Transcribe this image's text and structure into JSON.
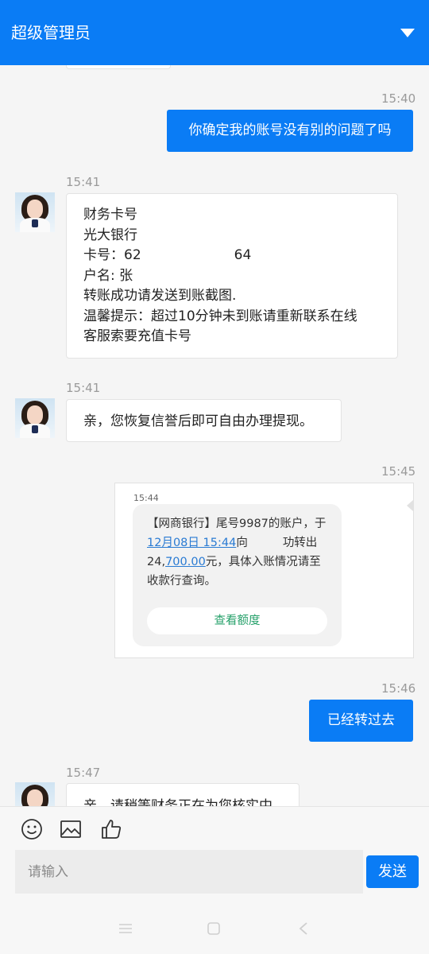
{
  "header": {
    "title": "超级管理员",
    "dropdown_icon": "chevron-down-icon"
  },
  "messages": {
    "m1": {
      "time": "15:40",
      "text": "你确定我的账号没有别的问题了吗"
    },
    "m2": {
      "time": "15:41",
      "lines": [
        "财务卡号",
        "光大银行",
        "卡号：62",
        "64",
        "户名: 张",
        "转账成功请发送到账截图.",
        "温馨提示：超过10分钟未到账请重新联系在线",
        "客服索要充值卡号"
      ]
    },
    "m3": {
      "time": "15:41",
      "text": "亲，您恢复信誉后即可自由办理提现。"
    },
    "m4": {
      "time": "15:45",
      "screenshot_time": "15:44",
      "sms_prefix": "【网商银行】尾号9987的账户，于",
      "sms_date": "12月08日 15:44",
      "sms_mid": "向",
      "sms_mid2": "功转出",
      "sms_amount_prefix": "24,",
      "sms_amount": "700.00",
      "sms_suffix": "元，具体入账情况请至",
      "sms_last": "收款行查询。",
      "sms_button": "查看额度"
    },
    "m5": {
      "time": "15:46",
      "text": "已经转过去"
    },
    "m6": {
      "time": "15:47",
      "text": "亲，请稍等财务正在为您核实中"
    }
  },
  "composer": {
    "placeholder": "请输入",
    "send_label": "发送"
  },
  "colors": {
    "accent": "#0a7cf5",
    "link": "#2a7bd3",
    "sms_button": "#27a16b"
  }
}
